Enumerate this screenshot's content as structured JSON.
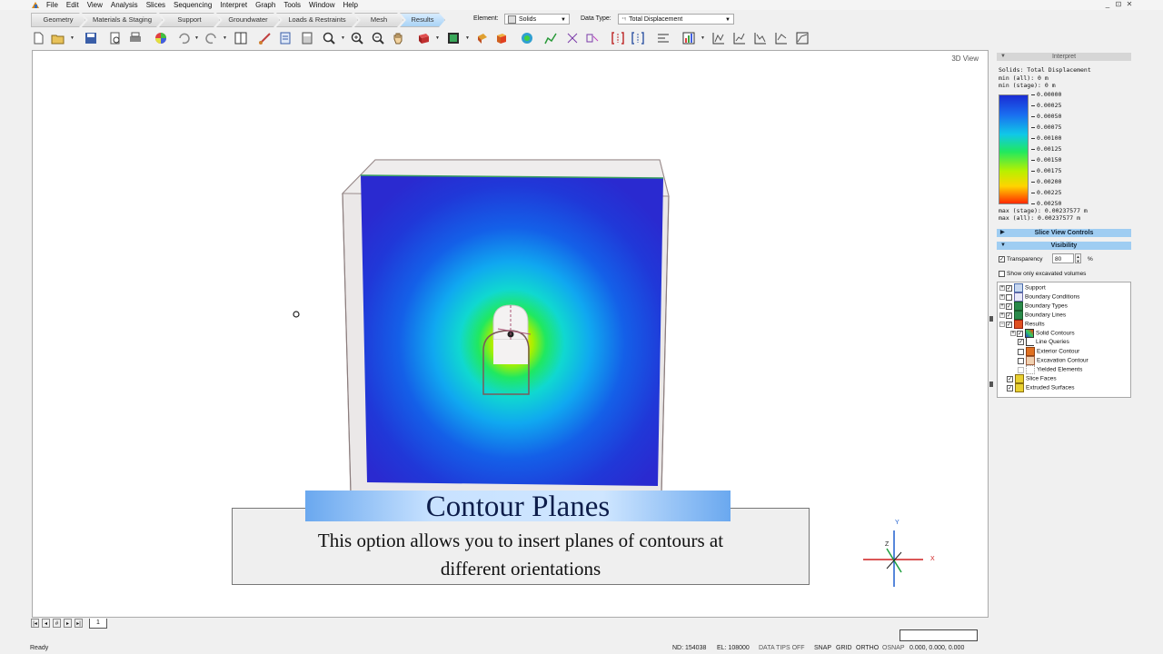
{
  "menu": [
    "File",
    "Edit",
    "View",
    "Analysis",
    "Slices",
    "Sequencing",
    "Interpret",
    "Graph",
    "Tools",
    "Window",
    "Help"
  ],
  "window_buttons": [
    "_",
    "⊡",
    "✕"
  ],
  "workflow_tabs": [
    "Geometry",
    "Materials & Staging",
    "Support",
    "Groundwater",
    "Loads & Restraints",
    "Mesh",
    "Results"
  ],
  "active_tab": "Results",
  "element": {
    "label": "Element:",
    "value": "Solids"
  },
  "data_type": {
    "label": "Data Type:",
    "value": "Total Displacement"
  },
  "view": {
    "label": "3D View",
    "sheet_tab": "1"
  },
  "caption": {
    "title": "Contour Planes",
    "line1": "This option allows you to insert planes of contours at",
    "line2": "different orientations"
  },
  "axes": {
    "x": "X",
    "y": "Y",
    "z": "Z"
  },
  "interpret": {
    "header": "Interpret",
    "title": "Solids: Total Displacement",
    "min_all": "min (all):     0 m",
    "min_stage": "min (stage):   0 m",
    "legend": [
      "0.00000",
      "0.00025",
      "0.00050",
      "0.00075",
      "0.00100",
      "0.00125",
      "0.00150",
      "0.00175",
      "0.00200",
      "0.00225",
      "0.00250"
    ],
    "max_stage": "max (stage):   0.00237577 m",
    "max_all": "max (all):     0.00237577 m"
  },
  "slice_view_controls": "Slice View Controls",
  "visibility": {
    "header": "Visibility",
    "transparency_label": "Transparency",
    "transparency_value": "80",
    "percent": "%",
    "excavated_label": "Show only excavated volumes",
    "tree": [
      {
        "label": "Support"
      },
      {
        "label": "Boundary Conditions"
      },
      {
        "label": "Boundary Types"
      },
      {
        "label": "Boundary Lines"
      },
      {
        "label": "Results"
      },
      {
        "label": "Solid Contours"
      },
      {
        "label": "Line Queries"
      },
      {
        "label": "Exterior Contour"
      },
      {
        "label": "Excavation Contour"
      },
      {
        "label": "Yielded Elements"
      },
      {
        "label": "Slice Faces"
      },
      {
        "label": "Extruded Surfaces"
      }
    ]
  },
  "status": {
    "ready": "Ready",
    "nd": "ND: 154038",
    "el": "EL: 108000",
    "tips": "DATA TIPS OFF",
    "snap": "SNAP",
    "grid": "GRID",
    "ortho": "ORTHO",
    "osnap": "OSNAP",
    "coords": "0.000,  0.000,  0.000"
  },
  "colors": {
    "accent": "#1e74d6",
    "panel_head": "#9fcdf2",
    "contour_max": "#ff2a00",
    "contour_min": "#1a2cd4"
  }
}
